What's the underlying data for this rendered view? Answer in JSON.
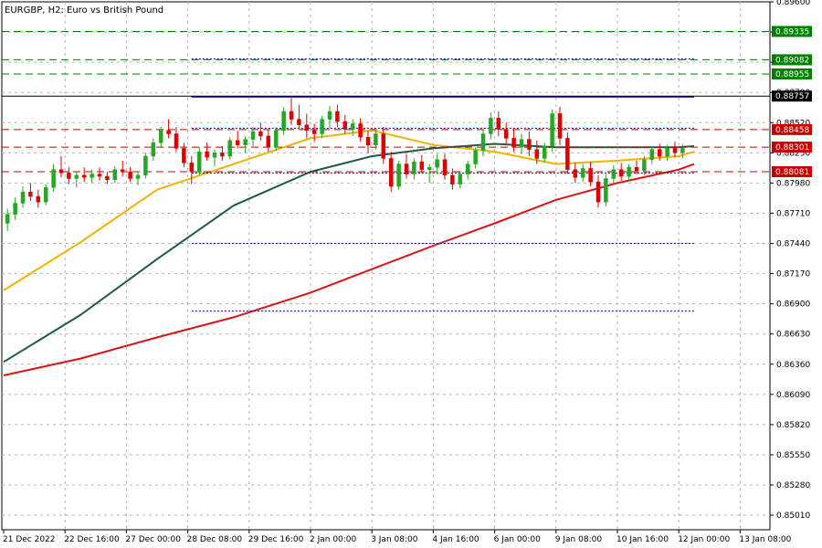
{
  "chart_data": {
    "type": "candlestick",
    "title": "EURGBP, H2:  Euro vs British Pound",
    "ylim": [
      0.8488,
      0.896
    ],
    "xlim": [
      0,
      90
    ],
    "y_ticks": [
      "0.89600",
      "0.89330",
      "0.89060",
      "0.88790",
      "0.88520",
      "0.88250",
      "0.87980",
      "0.87710",
      "0.87440",
      "0.87170",
      "0.86900",
      "0.86630",
      "0.86360",
      "0.86090",
      "0.85820",
      "0.85550",
      "0.85280",
      "0.85010"
    ],
    "x_ticks": [
      {
        "x": 0,
        "label": "21 Dec 2022"
      },
      {
        "x": 8,
        "label": "22 Dec 16:00"
      },
      {
        "x": 16,
        "label": "27 Dec 00:00"
      },
      {
        "x": 24,
        "label": "28 Dec 08:00"
      },
      {
        "x": 32,
        "label": "29 Dec 16:00"
      },
      {
        "x": 40,
        "label": "2 Jan 00:00"
      },
      {
        "x": 48,
        "label": "3 Jan 08:00"
      },
      {
        "x": 56,
        "label": "4 Jan 16:00"
      },
      {
        "x": 64,
        "label": "6 Jan 00:00"
      },
      {
        "x": 72,
        "label": "9 Jan 08:00"
      },
      {
        "x": 80,
        "label": "10 Jan 16:00"
      },
      {
        "x": 88,
        "label": "12 Jan 00:00"
      },
      {
        "x": 96,
        "label": "13 Jan 08:00"
      }
    ],
    "x_tick_spacing_bars": 8,
    "candles": [
      {
        "x": 0.5,
        "o": 0.8762,
        "h": 0.8775,
        "l": 0.8755,
        "c": 0.877
      },
      {
        "x": 1.5,
        "o": 0.877,
        "h": 0.8785,
        "l": 0.8765,
        "c": 0.878
      },
      {
        "x": 2.5,
        "o": 0.878,
        "h": 0.8795,
        "l": 0.8776,
        "c": 0.879
      },
      {
        "x": 3.5,
        "o": 0.879,
        "h": 0.8798,
        "l": 0.8782,
        "c": 0.8786
      },
      {
        "x": 4.5,
        "o": 0.8786,
        "h": 0.8792,
        "l": 0.8776,
        "c": 0.8781
      },
      {
        "x": 5.5,
        "o": 0.8781,
        "h": 0.8797,
        "l": 0.8778,
        "c": 0.8794
      },
      {
        "x": 6.5,
        "o": 0.8794,
        "h": 0.8815,
        "l": 0.879,
        "c": 0.881
      },
      {
        "x": 7.5,
        "o": 0.881,
        "h": 0.8822,
        "l": 0.8803,
        "c": 0.8807
      },
      {
        "x": 8.5,
        "o": 0.8807,
        "h": 0.8812,
        "l": 0.8797,
        "c": 0.8802
      },
      {
        "x": 9.5,
        "o": 0.8802,
        "h": 0.8808,
        "l": 0.8794,
        "c": 0.8805
      },
      {
        "x": 10.5,
        "o": 0.8805,
        "h": 0.8812,
        "l": 0.8799,
        "c": 0.8803
      },
      {
        "x": 11.5,
        "o": 0.8803,
        "h": 0.881,
        "l": 0.8798,
        "c": 0.8806
      },
      {
        "x": 12.5,
        "o": 0.8806,
        "h": 0.8812,
        "l": 0.88,
        "c": 0.8804
      },
      {
        "x": 13.5,
        "o": 0.8804,
        "h": 0.8808,
        "l": 0.8797,
        "c": 0.8801
      },
      {
        "x": 14.5,
        "o": 0.8801,
        "h": 0.8813,
        "l": 0.8798,
        "c": 0.881
      },
      {
        "x": 15.5,
        "o": 0.881,
        "h": 0.8818,
        "l": 0.8804,
        "c": 0.8808
      },
      {
        "x": 16.5,
        "o": 0.8808,
        "h": 0.8812,
        "l": 0.8799,
        "c": 0.8802
      },
      {
        "x": 17.5,
        "o": 0.8802,
        "h": 0.8808,
        "l": 0.8796,
        "c": 0.8805
      },
      {
        "x": 18.5,
        "o": 0.8805,
        "h": 0.8825,
        "l": 0.8802,
        "c": 0.8822
      },
      {
        "x": 19.5,
        "o": 0.8822,
        "h": 0.8838,
        "l": 0.8818,
        "c": 0.8834
      },
      {
        "x": 20.5,
        "o": 0.8834,
        "h": 0.8848,
        "l": 0.883,
        "c": 0.8845
      },
      {
        "x": 21.5,
        "o": 0.8845,
        "h": 0.8855,
        "l": 0.8838,
        "c": 0.8842
      },
      {
        "x": 22.5,
        "o": 0.8842,
        "h": 0.8848,
        "l": 0.8826,
        "c": 0.8829
      },
      {
        "x": 23.5,
        "o": 0.8829,
        "h": 0.8834,
        "l": 0.8812,
        "c": 0.8816
      },
      {
        "x": 24.5,
        "o": 0.8816,
        "h": 0.8822,
        "l": 0.8797,
        "c": 0.8808
      },
      {
        "x": 25.5,
        "o": 0.8808,
        "h": 0.883,
        "l": 0.8805,
        "c": 0.8826
      },
      {
        "x": 26.5,
        "o": 0.8826,
        "h": 0.8834,
        "l": 0.8818,
        "c": 0.8821
      },
      {
        "x": 27.5,
        "o": 0.8821,
        "h": 0.8828,
        "l": 0.8813,
        "c": 0.8825
      },
      {
        "x": 28.5,
        "o": 0.8825,
        "h": 0.8831,
        "l": 0.8818,
        "c": 0.8822
      },
      {
        "x": 29.5,
        "o": 0.8822,
        "h": 0.8839,
        "l": 0.8819,
        "c": 0.8836
      },
      {
        "x": 30.5,
        "o": 0.8836,
        "h": 0.8845,
        "l": 0.8829,
        "c": 0.8832
      },
      {
        "x": 31.5,
        "o": 0.8832,
        "h": 0.884,
        "l": 0.8825,
        "c": 0.8837
      },
      {
        "x": 32.5,
        "o": 0.8837,
        "h": 0.8848,
        "l": 0.8831,
        "c": 0.8844
      },
      {
        "x": 33.5,
        "o": 0.8844,
        "h": 0.8852,
        "l": 0.8836,
        "c": 0.884
      },
      {
        "x": 34.5,
        "o": 0.884,
        "h": 0.8846,
        "l": 0.8826,
        "c": 0.883
      },
      {
        "x": 35.5,
        "o": 0.883,
        "h": 0.8848,
        "l": 0.8827,
        "c": 0.8845
      },
      {
        "x": 36.5,
        "o": 0.8845,
        "h": 0.8866,
        "l": 0.8841,
        "c": 0.8862
      },
      {
        "x": 37.5,
        "o": 0.8862,
        "h": 0.8874,
        "l": 0.885,
        "c": 0.8855
      },
      {
        "x": 38.5,
        "o": 0.8855,
        "h": 0.8868,
        "l": 0.8847,
        "c": 0.885
      },
      {
        "x": 39.5,
        "o": 0.885,
        "h": 0.886,
        "l": 0.8838,
        "c": 0.8845
      },
      {
        "x": 40.5,
        "o": 0.8845,
        "h": 0.8851,
        "l": 0.8835,
        "c": 0.8842
      },
      {
        "x": 41.5,
        "o": 0.8842,
        "h": 0.8858,
        "l": 0.8838,
        "c": 0.8855
      },
      {
        "x": 42.5,
        "o": 0.8855,
        "h": 0.8867,
        "l": 0.8847,
        "c": 0.8862
      },
      {
        "x": 43.5,
        "o": 0.8862,
        "h": 0.8868,
        "l": 0.8848,
        "c": 0.8853
      },
      {
        "x": 44.5,
        "o": 0.8853,
        "h": 0.8859,
        "l": 0.8842,
        "c": 0.8846
      },
      {
        "x": 45.5,
        "o": 0.8846,
        "h": 0.8855,
        "l": 0.884,
        "c": 0.8851
      },
      {
        "x": 46.5,
        "o": 0.8851,
        "h": 0.8856,
        "l": 0.8835,
        "c": 0.8839
      },
      {
        "x": 47.5,
        "o": 0.8839,
        "h": 0.8845,
        "l": 0.8825,
        "c": 0.8832
      },
      {
        "x": 48.5,
        "o": 0.8832,
        "h": 0.8845,
        "l": 0.8828,
        "c": 0.8842
      },
      {
        "x": 49.5,
        "o": 0.8842,
        "h": 0.8848,
        "l": 0.8815,
        "c": 0.882
      },
      {
        "x": 50.5,
        "o": 0.882,
        "h": 0.8826,
        "l": 0.879,
        "c": 0.8795
      },
      {
        "x": 51.5,
        "o": 0.8795,
        "h": 0.8818,
        "l": 0.8792,
        "c": 0.8815
      },
      {
        "x": 52.5,
        "o": 0.8815,
        "h": 0.8824,
        "l": 0.8802,
        "c": 0.8806
      },
      {
        "x": 53.5,
        "o": 0.8806,
        "h": 0.882,
        "l": 0.8801,
        "c": 0.8817
      },
      {
        "x": 54.5,
        "o": 0.8817,
        "h": 0.8823,
        "l": 0.8807,
        "c": 0.881
      },
      {
        "x": 55.5,
        "o": 0.881,
        "h": 0.8815,
        "l": 0.8798,
        "c": 0.8812
      },
      {
        "x": 56.5,
        "o": 0.8812,
        "h": 0.8824,
        "l": 0.8806,
        "c": 0.8819
      },
      {
        "x": 57.5,
        "o": 0.8819,
        "h": 0.8824,
        "l": 0.8801,
        "c": 0.8805
      },
      {
        "x": 58.5,
        "o": 0.8805,
        "h": 0.8811,
        "l": 0.8792,
        "c": 0.8797
      },
      {
        "x": 59.5,
        "o": 0.8797,
        "h": 0.8809,
        "l": 0.8793,
        "c": 0.8806
      },
      {
        "x": 60.5,
        "o": 0.8806,
        "h": 0.8818,
        "l": 0.8801,
        "c": 0.8815
      },
      {
        "x": 61.5,
        "o": 0.8815,
        "h": 0.883,
        "l": 0.8811,
        "c": 0.8827
      },
      {
        "x": 62.5,
        "o": 0.8827,
        "h": 0.8846,
        "l": 0.8822,
        "c": 0.8842
      },
      {
        "x": 63.5,
        "o": 0.8842,
        "h": 0.8861,
        "l": 0.8837,
        "c": 0.8856
      },
      {
        "x": 64.5,
        "o": 0.8856,
        "h": 0.8862,
        "l": 0.884,
        "c": 0.8846
      },
      {
        "x": 65.5,
        "o": 0.8846,
        "h": 0.8852,
        "l": 0.8832,
        "c": 0.8838
      },
      {
        "x": 66.5,
        "o": 0.8838,
        "h": 0.8846,
        "l": 0.8826,
        "c": 0.883
      },
      {
        "x": 67.5,
        "o": 0.883,
        "h": 0.8842,
        "l": 0.8824,
        "c": 0.8837
      },
      {
        "x": 68.5,
        "o": 0.8837,
        "h": 0.8844,
        "l": 0.8822,
        "c": 0.8828
      },
      {
        "x": 69.5,
        "o": 0.8828,
        "h": 0.8836,
        "l": 0.8815,
        "c": 0.882
      },
      {
        "x": 70.5,
        "o": 0.882,
        "h": 0.8834,
        "l": 0.8816,
        "c": 0.8831
      },
      {
        "x": 71.5,
        "o": 0.8831,
        "h": 0.8864,
        "l": 0.8826,
        "c": 0.886
      },
      {
        "x": 72.5,
        "o": 0.886,
        "h": 0.8866,
        "l": 0.8832,
        "c": 0.8838
      },
      {
        "x": 73.5,
        "o": 0.8838,
        "h": 0.8843,
        "l": 0.8806,
        "c": 0.881
      },
      {
        "x": 74.5,
        "o": 0.881,
        "h": 0.8816,
        "l": 0.8798,
        "c": 0.8803
      },
      {
        "x": 75.5,
        "o": 0.8803,
        "h": 0.8815,
        "l": 0.8799,
        "c": 0.8811
      },
      {
        "x": 76.5,
        "o": 0.8811,
        "h": 0.8817,
        "l": 0.8795,
        "c": 0.8799
      },
      {
        "x": 77.5,
        "o": 0.8799,
        "h": 0.8805,
        "l": 0.8776,
        "c": 0.8781
      },
      {
        "x": 78.5,
        "o": 0.8781,
        "h": 0.8806,
        "l": 0.8777,
        "c": 0.8802
      },
      {
        "x": 79.5,
        "o": 0.8802,
        "h": 0.8814,
        "l": 0.8797,
        "c": 0.881
      },
      {
        "x": 80.5,
        "o": 0.881,
        "h": 0.8816,
        "l": 0.88,
        "c": 0.8804
      },
      {
        "x": 81.5,
        "o": 0.8804,
        "h": 0.8815,
        "l": 0.88,
        "c": 0.8812
      },
      {
        "x": 82.5,
        "o": 0.8812,
        "h": 0.8818,
        "l": 0.8806,
        "c": 0.8809
      },
      {
        "x": 83.5,
        "o": 0.8809,
        "h": 0.8822,
        "l": 0.8805,
        "c": 0.8819
      },
      {
        "x": 84.5,
        "o": 0.8819,
        "h": 0.8831,
        "l": 0.8815,
        "c": 0.8828
      },
      {
        "x": 85.5,
        "o": 0.8828,
        "h": 0.8833,
        "l": 0.8818,
        "c": 0.8822
      },
      {
        "x": 86.5,
        "o": 0.8822,
        "h": 0.8832,
        "l": 0.8818,
        "c": 0.8829
      },
      {
        "x": 87.5,
        "o": 0.8829,
        "h": 0.8835,
        "l": 0.8821,
        "c": 0.8825
      },
      {
        "x": 88.5,
        "o": 0.8825,
        "h": 0.8833,
        "l": 0.882,
        "c": 0.8829
      }
    ],
    "moving_averages": [
      {
        "color": "#f0b400",
        "points": [
          [
            0,
            0.8702
          ],
          [
            10,
            0.8745
          ],
          [
            20,
            0.8792
          ],
          [
            30,
            0.8815
          ],
          [
            40,
            0.8838
          ],
          [
            48,
            0.8845
          ],
          [
            56,
            0.8832
          ],
          [
            64,
            0.8826
          ],
          [
            72,
            0.8815
          ],
          [
            80,
            0.8818
          ],
          [
            88,
            0.8822
          ],
          [
            90,
            0.8826
          ]
        ]
      },
      {
        "color": "#1e5c4a",
        "points": [
          [
            0,
            0.8638
          ],
          [
            10,
            0.868
          ],
          [
            20,
            0.873
          ],
          [
            30,
            0.8778
          ],
          [
            40,
            0.8808
          ],
          [
            48,
            0.8822
          ],
          [
            56,
            0.8829
          ],
          [
            64,
            0.8833
          ],
          [
            72,
            0.883
          ],
          [
            80,
            0.883
          ],
          [
            88,
            0.883
          ],
          [
            90,
            0.8831
          ]
        ]
      },
      {
        "color": "#dc1414",
        "points": [
          [
            0,
            0.8626
          ],
          [
            10,
            0.8641
          ],
          [
            20,
            0.866
          ],
          [
            30,
            0.8678
          ],
          [
            40,
            0.87
          ],
          [
            48,
            0.8721
          ],
          [
            56,
            0.8742
          ],
          [
            64,
            0.8762
          ],
          [
            72,
            0.8783
          ],
          [
            80,
            0.8798
          ],
          [
            88,
            0.881
          ],
          [
            90,
            0.8815
          ]
        ]
      }
    ],
    "h_lines": [
      {
        "value": 0.89335,
        "color": "#008000",
        "dash": "8,5",
        "label": "0.89335",
        "tag_bg": "#008000"
      },
      {
        "value": 0.89082,
        "color": "#008000",
        "dash": "8,5",
        "label": "0.89082",
        "tag_bg": "#008000"
      },
      {
        "value": 0.88955,
        "color": "#008000",
        "dash": "8,5",
        "label": "0.88955",
        "tag_bg": "#008000"
      },
      {
        "value": 0.88757,
        "color": "#000000",
        "dash": "",
        "label": "0.88757",
        "tag_bg": "#000000"
      },
      {
        "value": 0.88458,
        "color": "#c80000",
        "dash": "8,5",
        "label": "0.88458",
        "tag_bg": "#c80000"
      },
      {
        "value": 0.88301,
        "color": "#c80000",
        "dash": "8,5",
        "label": "0.88301",
        "tag_bg": "#c80000"
      },
      {
        "value": 0.88081,
        "color": "#c80000",
        "dash": "8,5",
        "label": "0.88081",
        "tag_bg": "#c80000"
      }
    ],
    "segments": [
      {
        "x1": 24.5,
        "x2": 90,
        "y": 0.8909,
        "color": "#000080",
        "dash": "2,2",
        "width": 1
      },
      {
        "x1": 24.5,
        "x2": 90,
        "y": 0.8875,
        "color": "#1e1ea0",
        "dash": "",
        "width": 1.5
      },
      {
        "x1": 24.5,
        "x2": 90,
        "y": 0.8847,
        "color": "#000080",
        "dash": "2,2",
        "width": 1
      },
      {
        "x1": 24.5,
        "x2": 90,
        "y": 0.8807,
        "color": "#000080",
        "dash": "2,2",
        "width": 1
      },
      {
        "x1": 24.5,
        "x2": 90,
        "y": 0.8744,
        "color": "#000080",
        "dash": "2,2",
        "width": 1
      },
      {
        "x1": 24.5,
        "x2": 90,
        "y": 0.86835,
        "color": "#000080",
        "dash": "2,2",
        "width": 1
      }
    ],
    "grid": true,
    "bull_color": "#26a626",
    "bear_color": "#e00000"
  }
}
